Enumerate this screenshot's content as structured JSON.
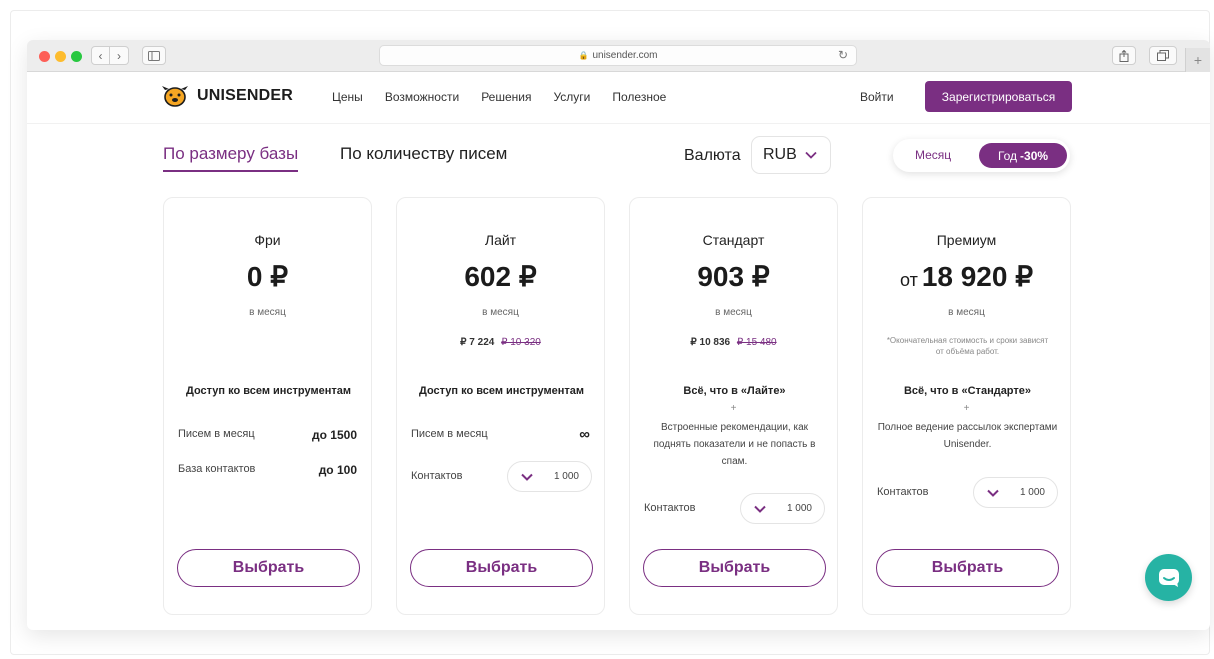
{
  "browser": {
    "url": "unisender.com"
  },
  "header": {
    "logo_text": "UNISENDER",
    "nav": [
      "Цены",
      "Возможности",
      "Решения",
      "Услуги",
      "Полезное"
    ],
    "login": "Войти",
    "register": "Зарегистрироваться"
  },
  "filters": {
    "tab_size": "По размеру базы",
    "tab_count": "По количеству писем",
    "currency_label": "Валюта",
    "currency_value": "RUB",
    "period_month": "Месяц",
    "period_year": "Год",
    "period_discount": "-30%"
  },
  "plans": [
    {
      "name": "Фри",
      "price": "0 ₽",
      "period": "в месяц",
      "feature": "Доступ ко всем инструментам",
      "rows": [
        {
          "label": "Писем в месяц",
          "value": "до 1500"
        },
        {
          "label": "База контактов",
          "value": "до 100"
        }
      ],
      "button": "Выбрать"
    },
    {
      "name": "Лайт",
      "price": "602 ₽",
      "period": "в месяц",
      "annual_now": "₽ 7 224",
      "annual_old": "₽ 10 320",
      "feature": "Доступ ко всем инструментам",
      "rows": [
        {
          "label": "Писем в месяц",
          "value": "∞"
        }
      ],
      "contacts_label": "Контактов",
      "contacts_value": "1 000",
      "button": "Выбрать"
    },
    {
      "name": "Стандарт",
      "price": "903 ₽",
      "period": "в месяц",
      "annual_now": "₽ 10 836",
      "annual_old": "₽ 15 480",
      "feature": "Всё, что в «Лайте»",
      "plus": "+",
      "description": "Встроенные рекомендации, как поднять показатели и не попасть в спам.",
      "contacts_label": "Контактов",
      "contacts_value": "1 000",
      "button": "Выбрать"
    },
    {
      "name": "Премиум",
      "price_prefix": "от",
      "price": "18 920 ₽",
      "period": "в месяц",
      "note": "*Окончательная стоимость и сроки зависят от объёма работ.",
      "feature": "Всё, что в «Стандарте»",
      "plus": "+",
      "description": "Полное ведение рассылок экспертами Unisender.",
      "contacts_label": "Контактов",
      "contacts_value": "1 000",
      "button": "Выбрать"
    }
  ],
  "colors": {
    "brand": "#7a2f82",
    "chat": "#26b3a4"
  },
  "icons": {
    "chat": "chat-icon",
    "chevron": "chevron-down-icon",
    "logo": "dog-logo-icon"
  }
}
